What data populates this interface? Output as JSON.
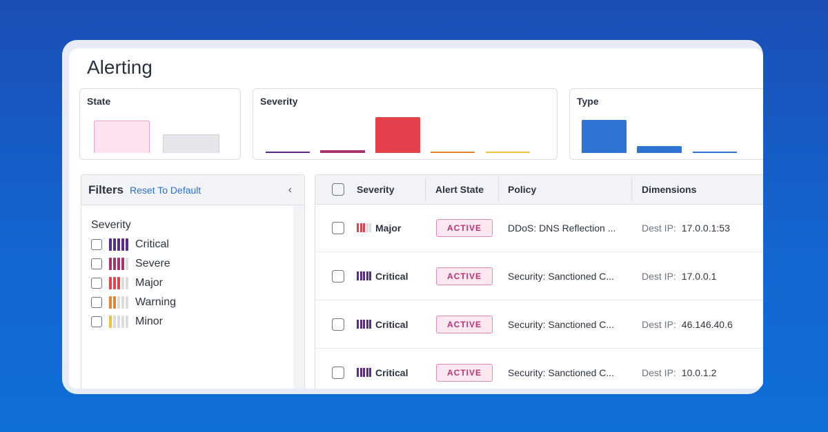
{
  "page": {
    "title": "Alerting"
  },
  "summary_cards": {
    "state": {
      "label": "State"
    },
    "severity": {
      "label": "Severity"
    },
    "type": {
      "label": "Type"
    }
  },
  "colors": {
    "critical": "#5b2a8f",
    "severe": "#a8326e",
    "major": "#e5414c",
    "warning": "#e7822f",
    "minor": "#eec23a",
    "inactive_seg": "#dcdcdc",
    "active_badge_text": "#c0306f",
    "link": "#2b6fd6",
    "type_bar": "#2e74d4"
  },
  "filters": {
    "title": "Filters",
    "reset_label": "Reset To Default",
    "collapse_icon": "chevron-left-icon",
    "collapse_glyph": "‹",
    "section_label": "Severity",
    "items": [
      {
        "label": "Critical",
        "level": 5,
        "color": "critical",
        "checked": false
      },
      {
        "label": "Severe",
        "level": 4,
        "color": "severe",
        "checked": false
      },
      {
        "label": "Major",
        "level": 3,
        "color": "major",
        "checked": false
      },
      {
        "label": "Warning",
        "level": 2,
        "color": "warning",
        "checked": false
      },
      {
        "label": "Minor",
        "level": 1,
        "color": "minor",
        "checked": false
      }
    ]
  },
  "table": {
    "columns": [
      "Severity",
      "Alert State",
      "Policy",
      "Dimensions"
    ],
    "rows": [
      {
        "severity": "Major",
        "level": 3,
        "color": "major",
        "state": "ACTIVE",
        "policy": "DDoS: DNS Reflection ...",
        "dim_key": "Dest IP:",
        "dim_val": "17.0.0.1:53"
      },
      {
        "severity": "Critical",
        "level": 5,
        "color": "critical",
        "state": "ACTIVE",
        "policy": "Security: Sanctioned C...",
        "dim_key": "Dest IP:",
        "dim_val": "17.0.0.1"
      },
      {
        "severity": "Critical",
        "level": 5,
        "color": "critical",
        "state": "ACTIVE",
        "policy": "Security: Sanctioned C...",
        "dim_key": "Dest IP:",
        "dim_val": "46.146.40.6"
      },
      {
        "severity": "Critical",
        "level": 5,
        "color": "critical",
        "state": "ACTIVE",
        "policy": "Security: Sanctioned C...",
        "dim_key": "Dest IP:",
        "dim_val": "10.0.1.2"
      }
    ]
  }
}
